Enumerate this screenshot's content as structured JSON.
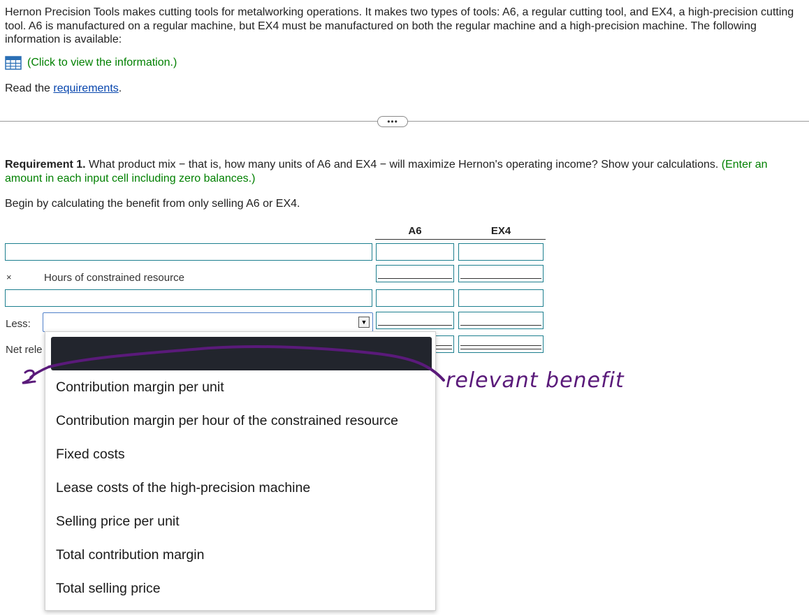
{
  "intro": {
    "text": "Hernon Precision Tools makes cutting tools for metalworking operations. It makes two types of tools: A6, a regular cutting tool, and EX4, a high-precision cutting tool. A6 is manufactured on a regular machine, but EX4 must be manufactured on both the regular machine and a high-precision machine. The following information is available:"
  },
  "info_link": {
    "label": "(Click to view the information.)",
    "icon": "table-grid-icon"
  },
  "read_requirements": {
    "prefix": "Read the ",
    "link": "requirements",
    "suffix": "."
  },
  "divider_button": {
    "label": "•••"
  },
  "requirement1": {
    "bold": "Requirement 1.",
    "question": " What product mix − that is, how many units of A6 and EX4 − will maximize Hernon's operating income? Show your calculations. ",
    "hint": "(Enter an amount in each input cell including zero balances.)"
  },
  "begin_text": "Begin by calculating the benefit from only selling A6 or EX4.",
  "table": {
    "col_a6": "A6",
    "col_ex4": "EX4",
    "row2_prefix": "×",
    "row2_label": "Hours of constrained resource",
    "row4_label": "Less:",
    "row5_label_partial": "Net rele"
  },
  "dropdown": {
    "options": [
      "Contribution margin per unit",
      "Contribution margin per hour of the constrained resource",
      "Fixed costs",
      "Lease costs of the high-precision machine",
      "Selling price per unit",
      "Total contribution margin",
      "Total selling price"
    ]
  },
  "annotation": {
    "text": "relevant benefit",
    "color": "#5a1a7a"
  },
  "colors": {
    "link_green": "#008000",
    "input_border": "#1d7f8f",
    "annotation_ink": "#5a1a7a"
  }
}
